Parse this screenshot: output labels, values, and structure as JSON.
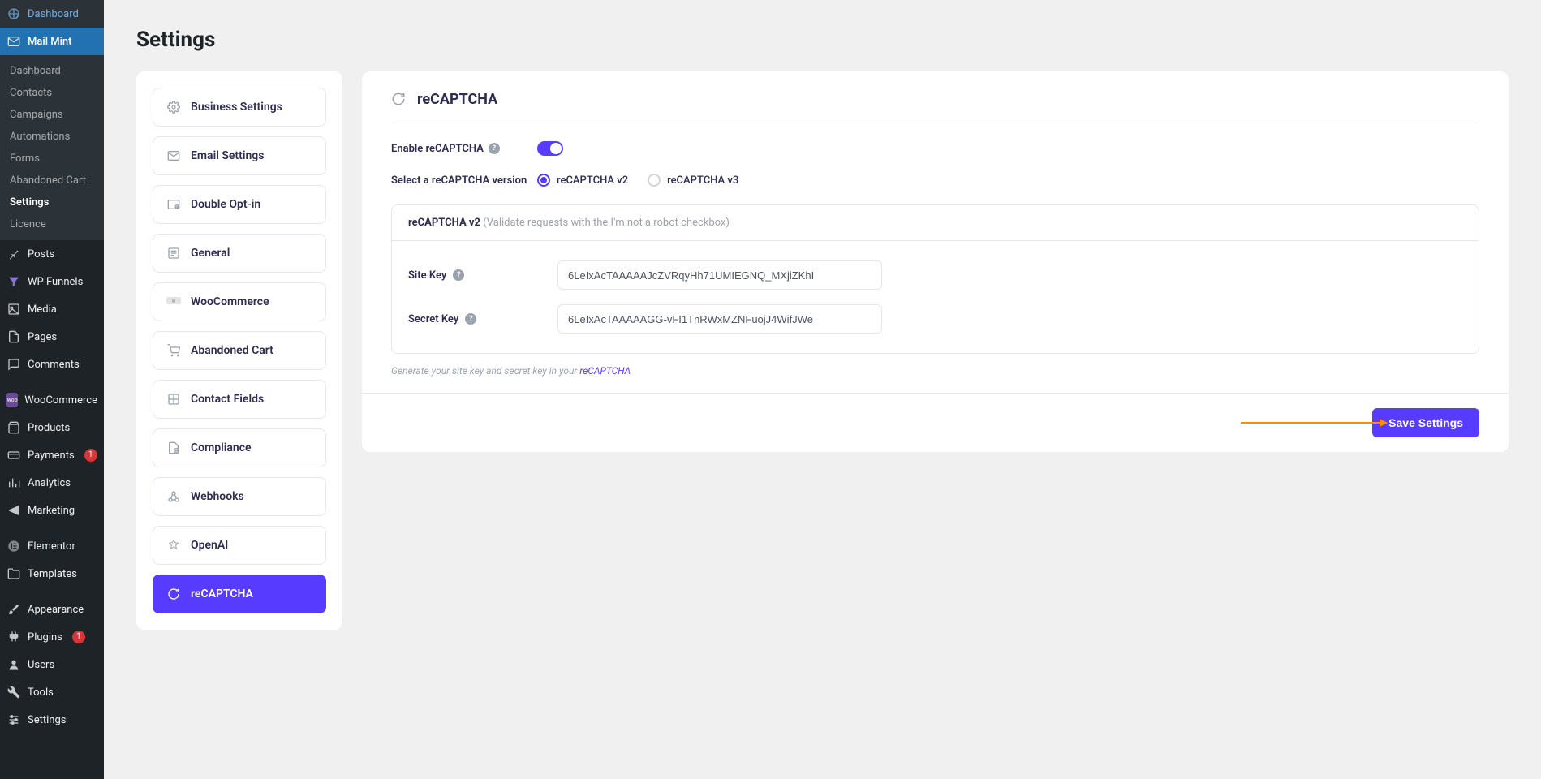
{
  "sidebar": {
    "main": [
      {
        "label": "Dashboard",
        "icon": "dashboard"
      },
      {
        "label": "Mail Mint",
        "icon": "mail",
        "active": true
      }
    ],
    "sub": [
      {
        "label": "Dashboard"
      },
      {
        "label": "Contacts"
      },
      {
        "label": "Campaigns"
      },
      {
        "label": "Automations"
      },
      {
        "label": "Forms"
      },
      {
        "label": "Abandoned Cart"
      },
      {
        "label": "Settings",
        "current": true
      },
      {
        "label": "Licence"
      }
    ],
    "rest": [
      {
        "label": "Posts",
        "icon": "pin"
      },
      {
        "label": "WP Funnels",
        "icon": "funnel"
      },
      {
        "label": "Media",
        "icon": "media"
      },
      {
        "label": "Pages",
        "icon": "page"
      },
      {
        "label": "Comments",
        "icon": "comment"
      },
      {
        "label": "WooCommerce",
        "icon": "woo"
      },
      {
        "label": "Products",
        "icon": "products"
      },
      {
        "label": "Payments",
        "icon": "payments",
        "badge": "1"
      },
      {
        "label": "Analytics",
        "icon": "analytics"
      },
      {
        "label": "Marketing",
        "icon": "marketing"
      },
      {
        "label": "Elementor",
        "icon": "elementor"
      },
      {
        "label": "Templates",
        "icon": "templates"
      },
      {
        "label": "Appearance",
        "icon": "brush"
      },
      {
        "label": "Plugins",
        "icon": "plugin",
        "badge": "1"
      },
      {
        "label": "Users",
        "icon": "users"
      },
      {
        "label": "Tools",
        "icon": "tools"
      },
      {
        "label": "Settings",
        "icon": "settings"
      }
    ]
  },
  "page": {
    "title": "Settings"
  },
  "settings_nav": [
    {
      "label": "Business Settings",
      "icon": "gear"
    },
    {
      "label": "Email Settings",
      "icon": "mail"
    },
    {
      "label": "Double Opt-in",
      "icon": "optin"
    },
    {
      "label": "General",
      "icon": "general"
    },
    {
      "label": "WooCommerce",
      "icon": "woologo"
    },
    {
      "label": "Abandoned Cart",
      "icon": "cart"
    },
    {
      "label": "Contact Fields",
      "icon": "fields"
    },
    {
      "label": "Compliance",
      "icon": "compliance"
    },
    {
      "label": "Webhooks",
      "icon": "webhooks"
    },
    {
      "label": "OpenAI",
      "icon": "openai"
    },
    {
      "label": "reCAPTCHA",
      "icon": "recaptcha",
      "active": true
    }
  ],
  "panel": {
    "title": "reCAPTCHA",
    "enable_label": "Enable reCAPTCHA",
    "toggle_on": true,
    "version_label": "Select a reCAPTCHA version",
    "options": [
      {
        "label": "reCAPTCHA v2",
        "selected": true
      },
      {
        "label": "reCAPTCHA v3",
        "selected": false
      }
    ],
    "box": {
      "title": "reCAPTCHA v2",
      "hint": "(Validate requests with the I'm not a robot checkbox)",
      "site_key_label": "Site Key",
      "site_key_value": "6LeIxAcTAAAAAJcZVRqyHh71UMIEGNQ_MXjiZKhI",
      "secret_key_label": "Secret Key",
      "secret_key_value": "6LeIxAcTAAAAAGG-vFI1TnRWxMZNFuojJ4WifJWe"
    },
    "note_prefix": "Generate your site key and secret key in your ",
    "note_link": "reCAPTCHA",
    "save_label": "Save Settings"
  }
}
